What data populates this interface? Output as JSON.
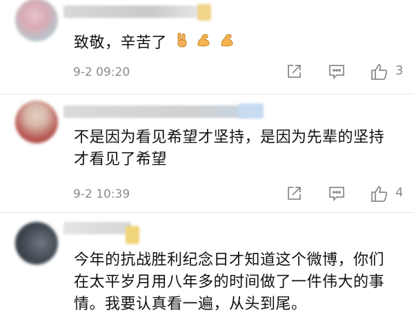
{
  "comments": [
    {
      "text": "致敬，辛苦了",
      "emoji": [
        "victory-hand-emoji",
        "flexed-biceps-emoji",
        "flexed-biceps-emoji"
      ],
      "time": "9-2 09:20",
      "likes": "3"
    },
    {
      "text": "不是因为看见希望才坚持，是因为先辈的坚持才看见了希望",
      "time": "9-2 10:39",
      "likes": "4"
    },
    {
      "text": "今年的抗战胜利纪念日才知道这个微博，你们在太平岁月用八年多的时间做了一件伟大的事情。我要认真看一遍，从头到尾。"
    }
  ],
  "colors": {
    "meta_text": "#8a8a8a",
    "divider": "#e6e6e6",
    "icon_stroke": "#8a8a8a"
  }
}
